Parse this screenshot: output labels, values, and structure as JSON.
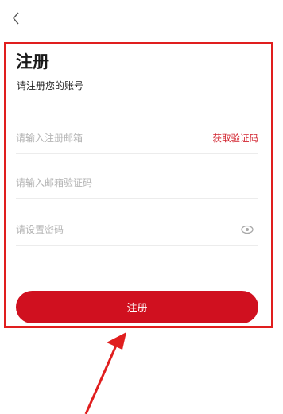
{
  "header": {
    "back_icon": "chevron-left-icon"
  },
  "form": {
    "title": "注册",
    "subtitle": "请注册您的账号",
    "email_placeholder": "请输入注册邮箱",
    "get_code_label": "获取验证码",
    "code_placeholder": "请输入邮箱验证码",
    "password_placeholder": "请设置密码",
    "password_toggle_icon": "eye-icon",
    "submit_label": "注册"
  },
  "colors": {
    "brand_red": "#d0101f",
    "annotation_red": "#e01e1e",
    "link_red": "#d2242f"
  }
}
